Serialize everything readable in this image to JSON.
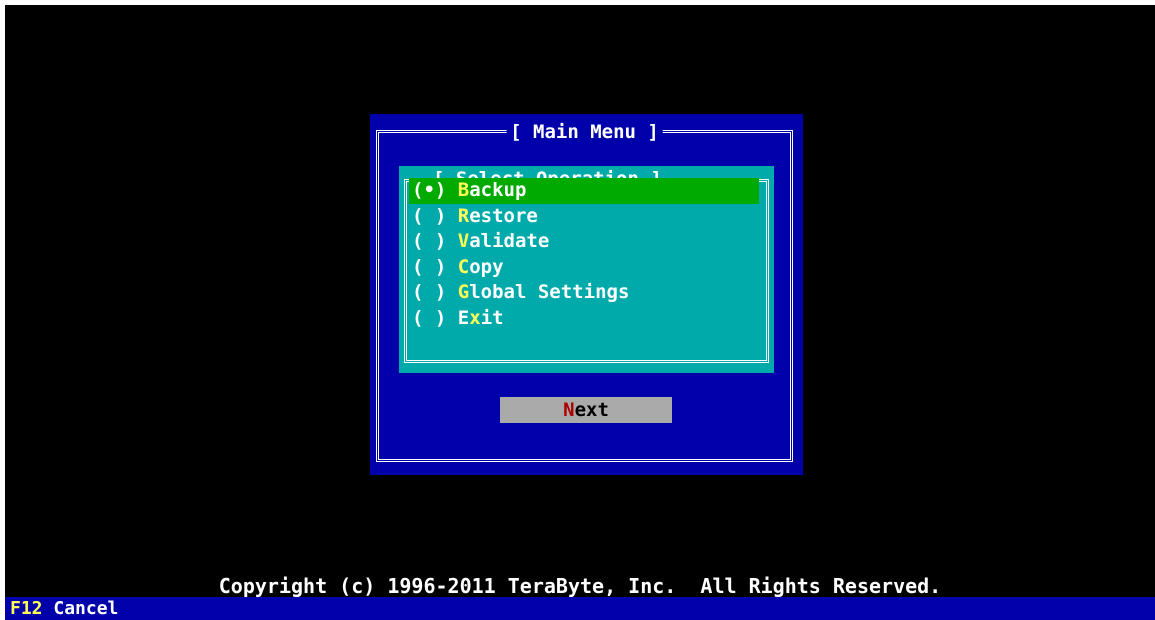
{
  "main_menu": {
    "title": "[ Main Menu ]",
    "operation_panel": {
      "title": "[ Select Operation ]",
      "items": [
        {
          "radio": "(•)",
          "hotkey": "B",
          "rest": "ackup",
          "selected": true
        },
        {
          "radio": "( )",
          "hotkey": "R",
          "rest": "estore",
          "selected": false
        },
        {
          "radio": "( )",
          "hotkey": "V",
          "rest": "alidate",
          "selected": false
        },
        {
          "radio": "( )",
          "hotkey": "C",
          "rest": "opy",
          "selected": false
        },
        {
          "radio": "( )",
          "hotkey": "G",
          "rest": "lobal Settings",
          "selected": false
        },
        {
          "radio": "( )",
          "prefix": "E",
          "hotkey": "x",
          "rest": "it",
          "selected": false
        }
      ]
    },
    "next_button": {
      "hotkey": "N",
      "rest": "ext"
    }
  },
  "copyright": "Copyright (c) 1996-2011 TeraByte, Inc.  All Rights Reserved.",
  "status_bar": {
    "key": "F12",
    "label": "Cancel"
  },
  "colors": {
    "screen_bg": "#000000",
    "window_bg": "#0000aa",
    "panel_bg": "#00aaaa",
    "selection_bg": "#00aa00",
    "hotkey": "#ffff55",
    "button_bg": "#aaaaaa",
    "button_hotkey": "#aa0000"
  }
}
